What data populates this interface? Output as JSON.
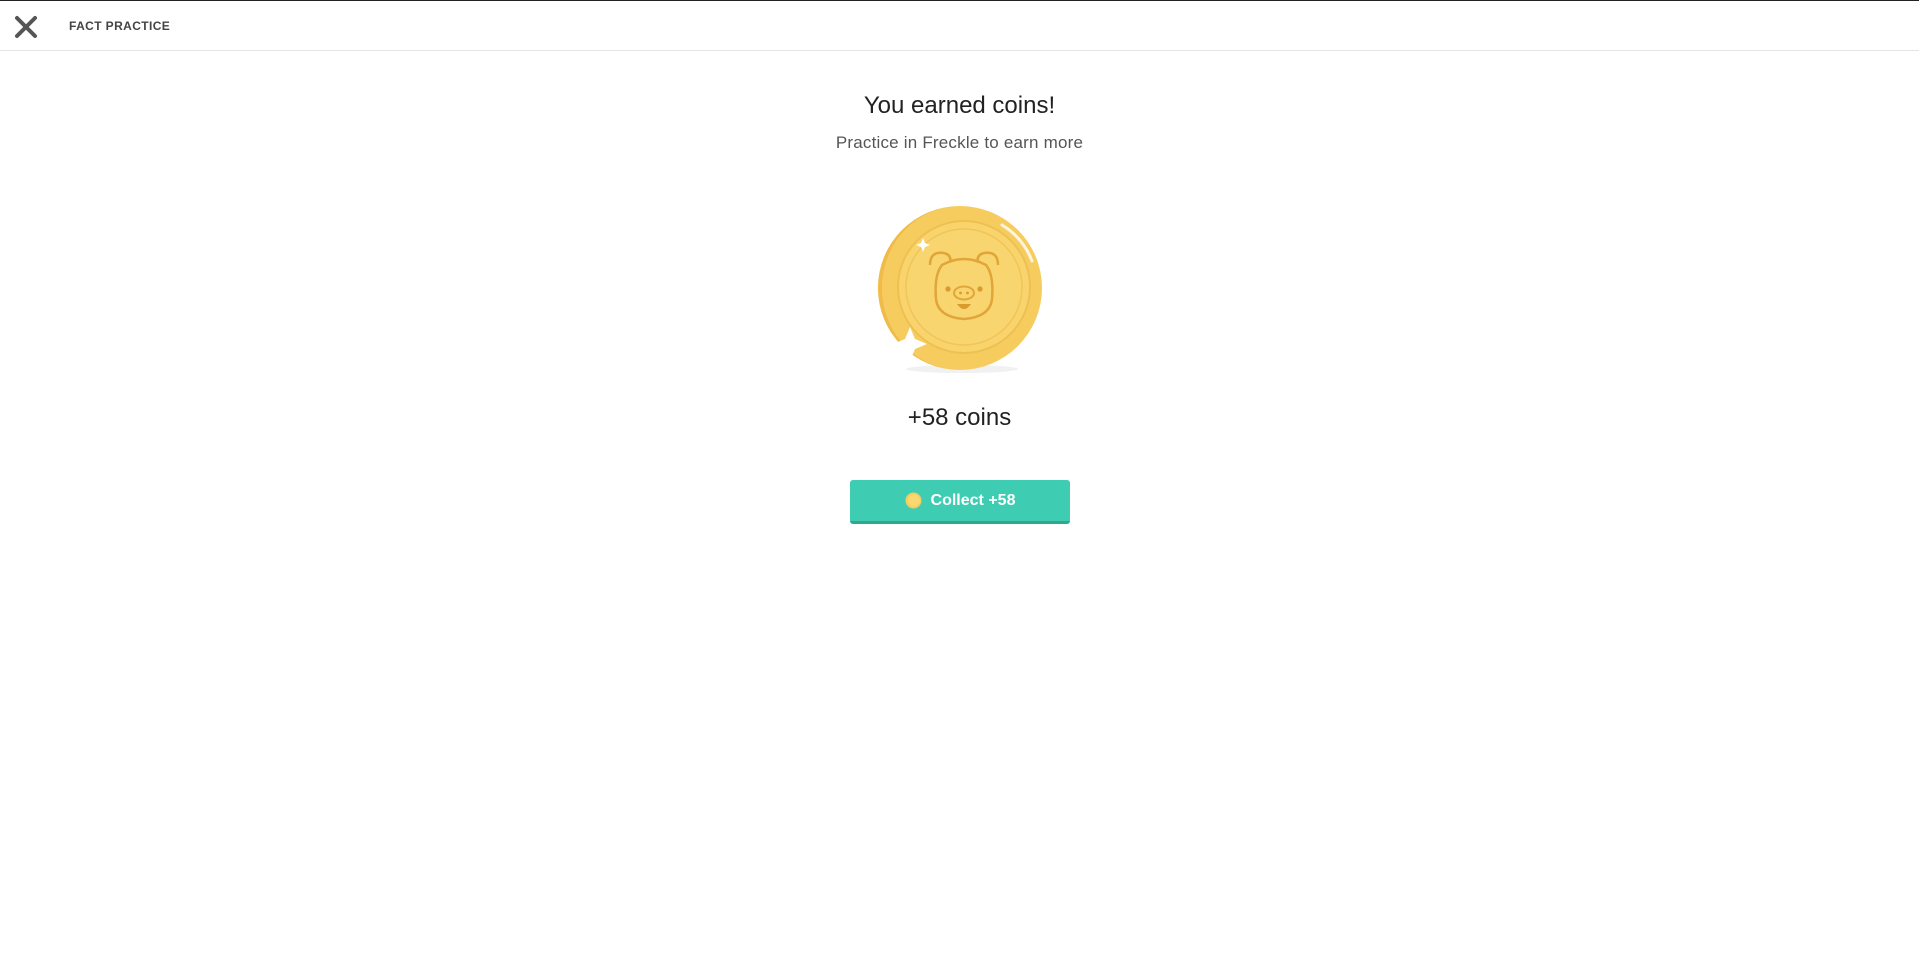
{
  "header": {
    "title": "FACT PRACTICE",
    "close_icon": "close-icon"
  },
  "reward": {
    "heading": "You earned coins!",
    "subheading": "Practice in Freckle to earn more",
    "coin_icon": "pig-coin-icon",
    "amount_text": "+58 coins",
    "collect_label": "Collect +58",
    "collect_icon": "coin-icon"
  },
  "colors": {
    "accent": "#3ecdb3",
    "coin_gold": "#f7cc5f",
    "coin_dark": "#e8b444"
  }
}
